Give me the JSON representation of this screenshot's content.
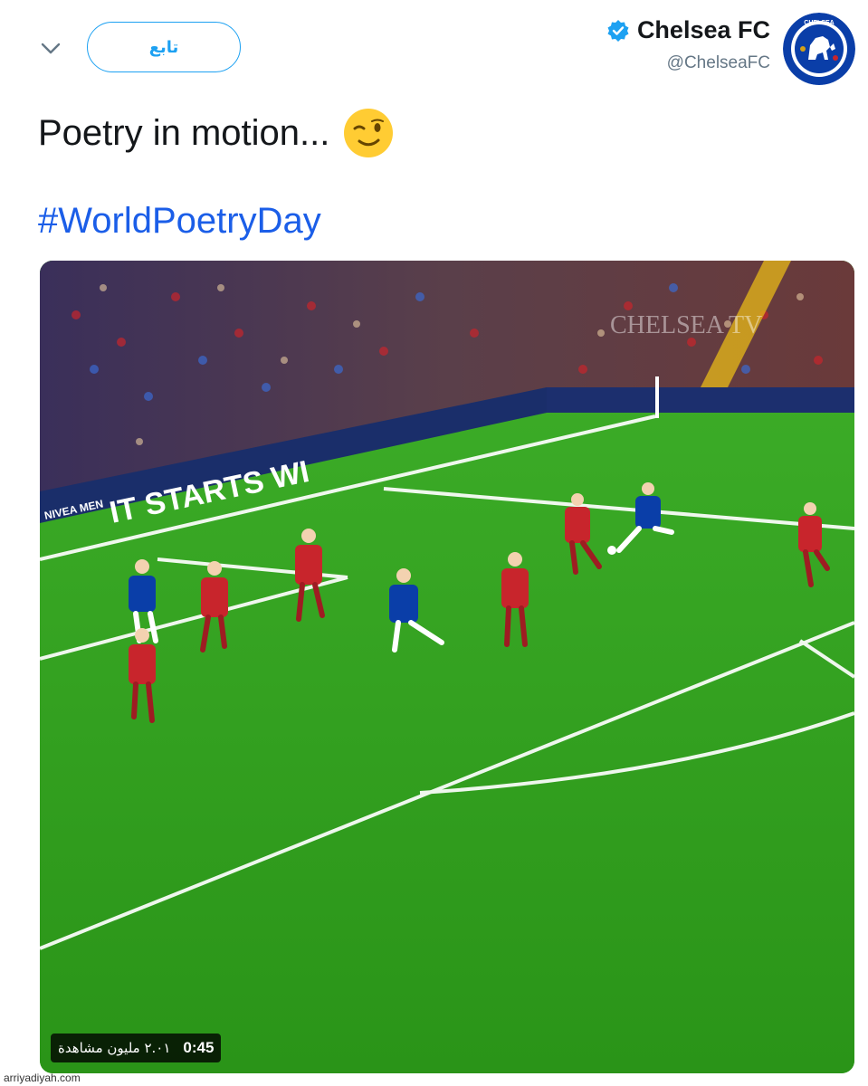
{
  "header": {
    "follow_label": "تابع",
    "account_name": "Chelsea FC",
    "account_handle": "@ChelseaFC",
    "avatar_text": "CHELSEA"
  },
  "tweet": {
    "text": "Poetry in motion...",
    "hashtag": "#WorldPoetryDay"
  },
  "video": {
    "board_text": "IT STARTS WI",
    "sponsor_text": "NIVEA MEN",
    "watermark": "CHELSEA TV",
    "duration": "0:45",
    "views": "٢.٠١ مليون مشاهدة"
  },
  "source": "arriyadiyah.com",
  "colors": {
    "accent": "#1da1f2",
    "hashtag": "#1b5ee8",
    "pitch": "#2f9d1e",
    "chelsea_blue": "#0a3ea8",
    "liverpool_red": "#c8252c"
  },
  "icons": [
    "chevron-down-icon",
    "verified-badge-icon",
    "chelsea-crest-icon",
    "winking-face-emoji"
  ]
}
